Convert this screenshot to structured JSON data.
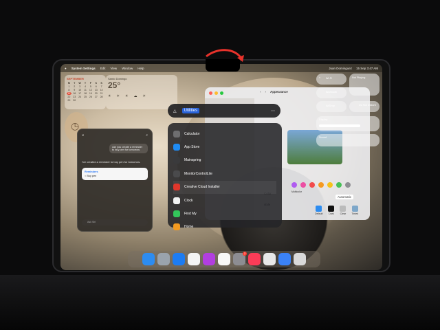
{
  "menubar": {
    "app_name": "System Settings",
    "menus": [
      "Edit",
      "View",
      "Window",
      "Help"
    ],
    "right_name": "Juan Dominguez",
    "right_datetime": "15 Sep 3:47 AM"
  },
  "calendar": {
    "month": "SEPTEMBER",
    "weekdays": [
      "M",
      "T",
      "W",
      "T",
      "F",
      "S",
      "S"
    ],
    "days": [
      "1",
      "2",
      "3",
      "4",
      "5",
      "6",
      "7",
      "8",
      "9",
      "10",
      "11",
      "12",
      "13",
      "14",
      "15",
      "16",
      "17",
      "18",
      "19",
      "20",
      "21",
      "22",
      "23",
      "24",
      "25",
      "26",
      "27",
      "28",
      "29",
      "30"
    ],
    "today": "15"
  },
  "weather": {
    "city": "Santo Domingo",
    "temp": "25°"
  },
  "siri": {
    "prompt": "can you create a reminder to buy pen for tomorrow",
    "reply": "I've created a reminder to buy pen for tomorrow.",
    "card_title": "Reminders",
    "card_item": "Buy pen",
    "ask_placeholder": "Ask Siri"
  },
  "spotlight": {
    "query": "Utilities",
    "items": [
      {
        "label": "Calculator",
        "icon": "calculator-icon",
        "color": "#6e6e70"
      },
      {
        "label": "App Store",
        "icon": "app-store-icon",
        "color": "#1f8cf5"
      },
      {
        "label": "Mainspring",
        "icon": "mainspring-icon",
        "color": "#3a3a3c"
      },
      {
        "label": "MonitorControlLite",
        "icon": "monitor-icon",
        "color": "#4a4a4c"
      },
      {
        "label": "Creative Cloud Installer",
        "icon": "creative-cloud-icon",
        "color": "#e0362b"
      },
      {
        "label": "Clock",
        "icon": "clock-icon",
        "color": "#f2f2f2"
      },
      {
        "label": "Find My",
        "icon": "find-my-icon",
        "color": "#33c55a"
      },
      {
        "label": "Home",
        "icon": "home-icon",
        "color": "#f49a20"
      }
    ]
  },
  "settings": {
    "title": "Appearance",
    "color_label": "Color",
    "multicolor_label": "Multicolor",
    "highlight_value": "Automatic",
    "icon_style_label": "style",
    "icon_options": [
      "Default",
      "Dark",
      "Clear",
      "Tinted"
    ],
    "swatch_colors": [
      "#b05cf0",
      "#ec4fa3",
      "#f24b4b",
      "#f59a22",
      "#f6c21a",
      "#47c057",
      "#8e8e93"
    ]
  },
  "control_center": {
    "wifi_label": "Wi-Fi",
    "bluetooth_label": "Bluetooth",
    "airdrop_label": "AirDrop",
    "focus_label": "Do Not Disturb",
    "display_label": "Display",
    "sound_label": "Sound",
    "now_playing": "Not Playing"
  },
  "dock": {
    "apps": [
      {
        "name": "finder-icon",
        "color": "#2d8cf0"
      },
      {
        "name": "launchpad-icon",
        "color": "#9aa3ad"
      },
      {
        "name": "safari-icon",
        "color": "#1d7cf2"
      },
      {
        "name": "freeform-icon",
        "color": "#f4f4f4"
      },
      {
        "name": "shortcuts-icon",
        "color": "#b23ee0"
      },
      {
        "name": "photos-icon",
        "color": "#f7f7f7"
      },
      {
        "name": "system-settings-icon",
        "color": "#8d8d92",
        "badge": "2"
      },
      {
        "name": "music-icon",
        "color": "#fb3c57"
      },
      {
        "name": "dark-app-icon",
        "color": "#e8e8e8"
      },
      {
        "name": "preview-icon",
        "color": "#3b82f6"
      },
      {
        "name": "trash-icon",
        "color": "#d9d9d9"
      }
    ]
  }
}
